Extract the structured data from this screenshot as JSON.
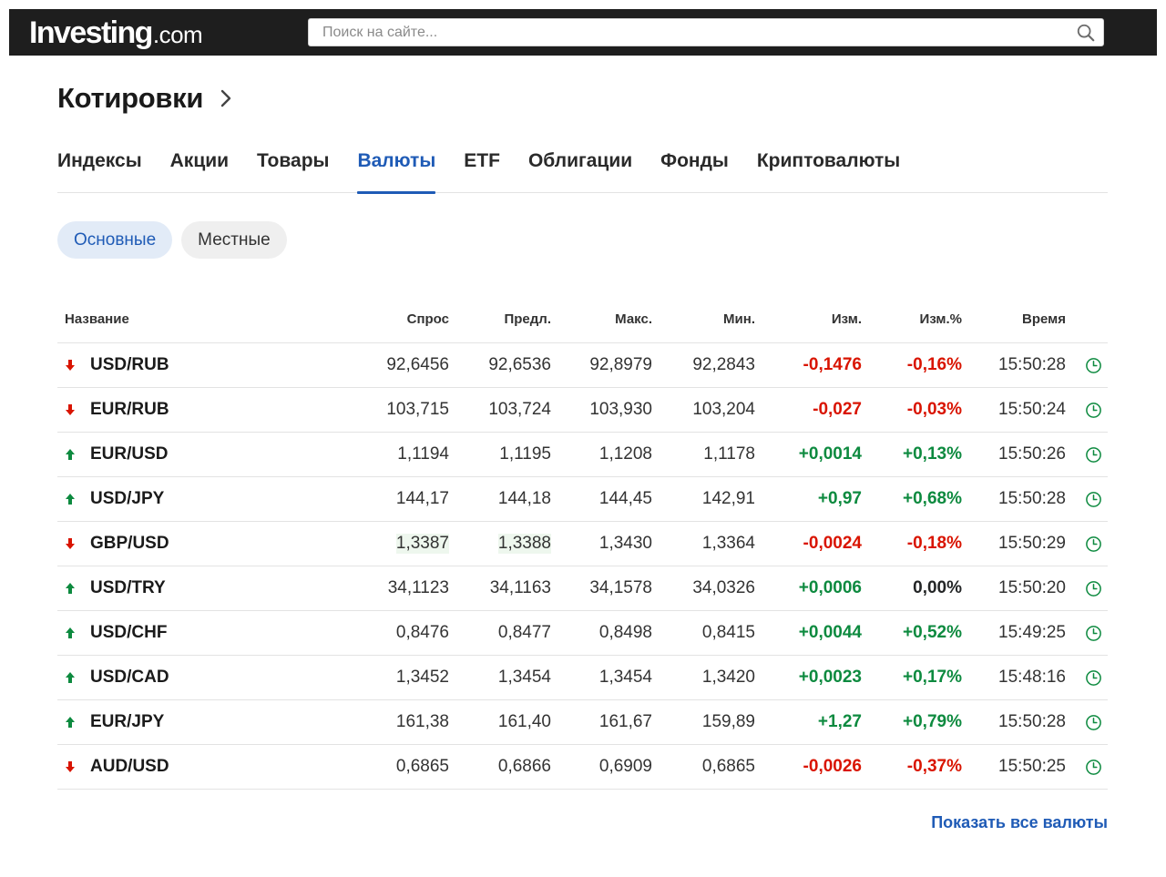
{
  "header": {
    "logo_brand": "Investing",
    "logo_tld": ".com",
    "search_placeholder": "Поиск на сайте..."
  },
  "page_title": "Котировки",
  "tabs": [
    {
      "label": "Индексы",
      "active": false
    },
    {
      "label": "Акции",
      "active": false
    },
    {
      "label": "Товары",
      "active": false
    },
    {
      "label": "Валюты",
      "active": true
    },
    {
      "label": "ETF",
      "active": false
    },
    {
      "label": "Облигации",
      "active": false
    },
    {
      "label": "Фонды",
      "active": false
    },
    {
      "label": "Криптовалюты",
      "active": false
    }
  ],
  "pills": [
    {
      "label": "Основные",
      "active": true
    },
    {
      "label": "Местные",
      "active": false
    }
  ],
  "table": {
    "headers": {
      "name": "Название",
      "bid": "Спрос",
      "ask": "Предл.",
      "high": "Макс.",
      "low": "Мин.",
      "change": "Изм.",
      "change_pct": "Изм.%",
      "time": "Время"
    },
    "rows": [
      {
        "name": "USD/RUB",
        "dir": "down",
        "bid": "92,6456",
        "ask": "92,6536",
        "high": "92,8979",
        "low": "92,2843",
        "change": "-0,1476",
        "change_pct": "-0,16%",
        "time": "15:50:28",
        "pct_dir": "down"
      },
      {
        "name": "EUR/RUB",
        "dir": "down",
        "bid": "103,715",
        "ask": "103,724",
        "high": "103,930",
        "low": "103,204",
        "change": "-0,027",
        "change_pct": "-0,03%",
        "time": "15:50:24",
        "pct_dir": "down"
      },
      {
        "name": "EUR/USD",
        "dir": "up",
        "bid": "1,1194",
        "ask": "1,1195",
        "high": "1,1208",
        "low": "1,1178",
        "change": "+0,0014",
        "change_pct": "+0,13%",
        "time": "15:50:26",
        "pct_dir": "up"
      },
      {
        "name": "USD/JPY",
        "dir": "up",
        "bid": "144,17",
        "ask": "144,18",
        "high": "144,45",
        "low": "142,91",
        "change": "+0,97",
        "change_pct": "+0,68%",
        "time": "15:50:28",
        "pct_dir": "up"
      },
      {
        "name": "GBP/USD",
        "dir": "down",
        "bid": "1,3387",
        "ask": "1,3388",
        "high": "1,3430",
        "low": "1,3364",
        "change": "-0,0024",
        "change_pct": "-0,18%",
        "time": "15:50:29",
        "pct_dir": "down",
        "highlight": true
      },
      {
        "name": "USD/TRY",
        "dir": "up",
        "bid": "34,1123",
        "ask": "34,1163",
        "high": "34,1578",
        "low": "34,0326",
        "change": "+0,0006",
        "change_pct": "0,00%",
        "time": "15:50:20",
        "pct_dir": "neutral"
      },
      {
        "name": "USD/CHF",
        "dir": "up",
        "bid": "0,8476",
        "ask": "0,8477",
        "high": "0,8498",
        "low": "0,8415",
        "change": "+0,0044",
        "change_pct": "+0,52%",
        "time": "15:49:25",
        "pct_dir": "up"
      },
      {
        "name": "USD/CAD",
        "dir": "up",
        "bid": "1,3452",
        "ask": "1,3454",
        "high": "1,3454",
        "low": "1,3420",
        "change": "+0,0023",
        "change_pct": "+0,17%",
        "time": "15:48:16",
        "pct_dir": "up"
      },
      {
        "name": "EUR/JPY",
        "dir": "up",
        "bid": "161,38",
        "ask": "161,40",
        "high": "161,67",
        "low": "159,89",
        "change": "+1,27",
        "change_pct": "+0,79%",
        "time": "15:50:28",
        "pct_dir": "up"
      },
      {
        "name": "AUD/USD",
        "dir": "down",
        "bid": "0,6865",
        "ask": "0,6866",
        "high": "0,6909",
        "low": "0,6865",
        "change": "-0,0026",
        "change_pct": "-0,37%",
        "time": "15:50:25",
        "pct_dir": "down"
      }
    ]
  },
  "show_all_link": "Показать все валюты",
  "colors": {
    "accent": "#1f5bb6",
    "up": "#0d8a3f",
    "down": "#d91400",
    "header_bg": "#1e1e1e",
    "pill_active_bg": "#e2ebf7"
  }
}
